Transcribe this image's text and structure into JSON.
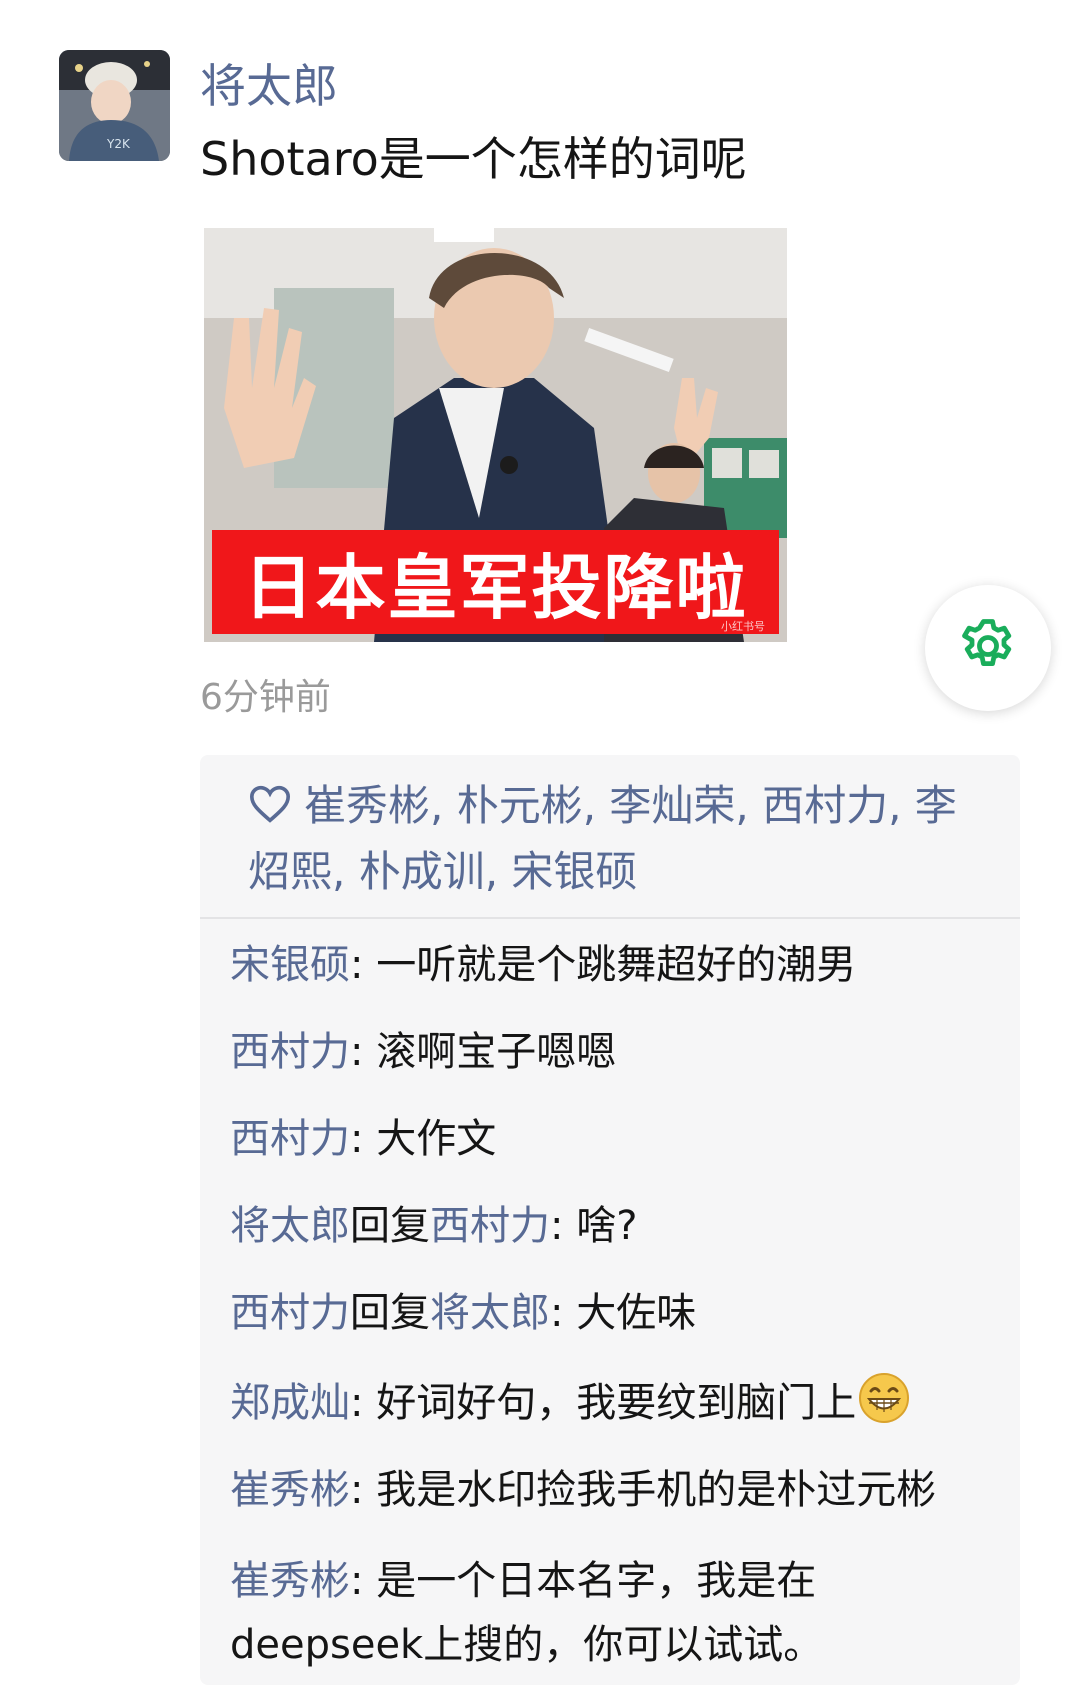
{
  "post": {
    "author": "将太郎",
    "text": "Shotaro是一个怎样的词呢",
    "image": {
      "caption": "日本皇军投降啦",
      "watermark": "小红书号"
    },
    "time": "6分钟前"
  },
  "likes": {
    "icon": "heart-icon",
    "names": "崔秀彬, 朴元彬, 李灿荣, 西村力, 李炤熙, 朴成训, 宋银硕"
  },
  "comments": [
    {
      "author": "宋银硕",
      "reply_word": "",
      "reply_to": "",
      "sep": ": ",
      "text": "一听就是个跳舞超好的潮男"
    },
    {
      "author": "西村力",
      "reply_word": "",
      "reply_to": "",
      "sep": ": ",
      "text": "滚啊宝子嗯嗯"
    },
    {
      "author": "西村力",
      "reply_word": "",
      "reply_to": "",
      "sep": ": ",
      "text": "大作文"
    },
    {
      "author": "将太郎",
      "reply_word": "回复",
      "reply_to": "西村力",
      "sep": ": ",
      "text": "啥?"
    },
    {
      "author": "西村力",
      "reply_word": "回复",
      "reply_to": "将太郎",
      "sep": ": ",
      "text": "大佐味"
    },
    {
      "author": "郑成灿",
      "reply_word": "",
      "reply_to": "",
      "sep": ": ",
      "text": "好词好句，我要纹到脑门上",
      "emoji": "grin-emoji"
    },
    {
      "author": "崔秀彬",
      "reply_word": "",
      "reply_to": "",
      "sep": ": ",
      "text": "我是水印捡我手机的是朴过元彬"
    },
    {
      "author": "崔秀彬",
      "reply_word": "",
      "reply_to": "",
      "sep": ": ",
      "text": "是一个日本名字，我是在deepseek上搜的，你可以试试。"
    }
  ],
  "colors": {
    "name": "#586a94",
    "banner": "#f0171a",
    "gear": "#1aad5b",
    "panel": "#f6f6f7"
  }
}
